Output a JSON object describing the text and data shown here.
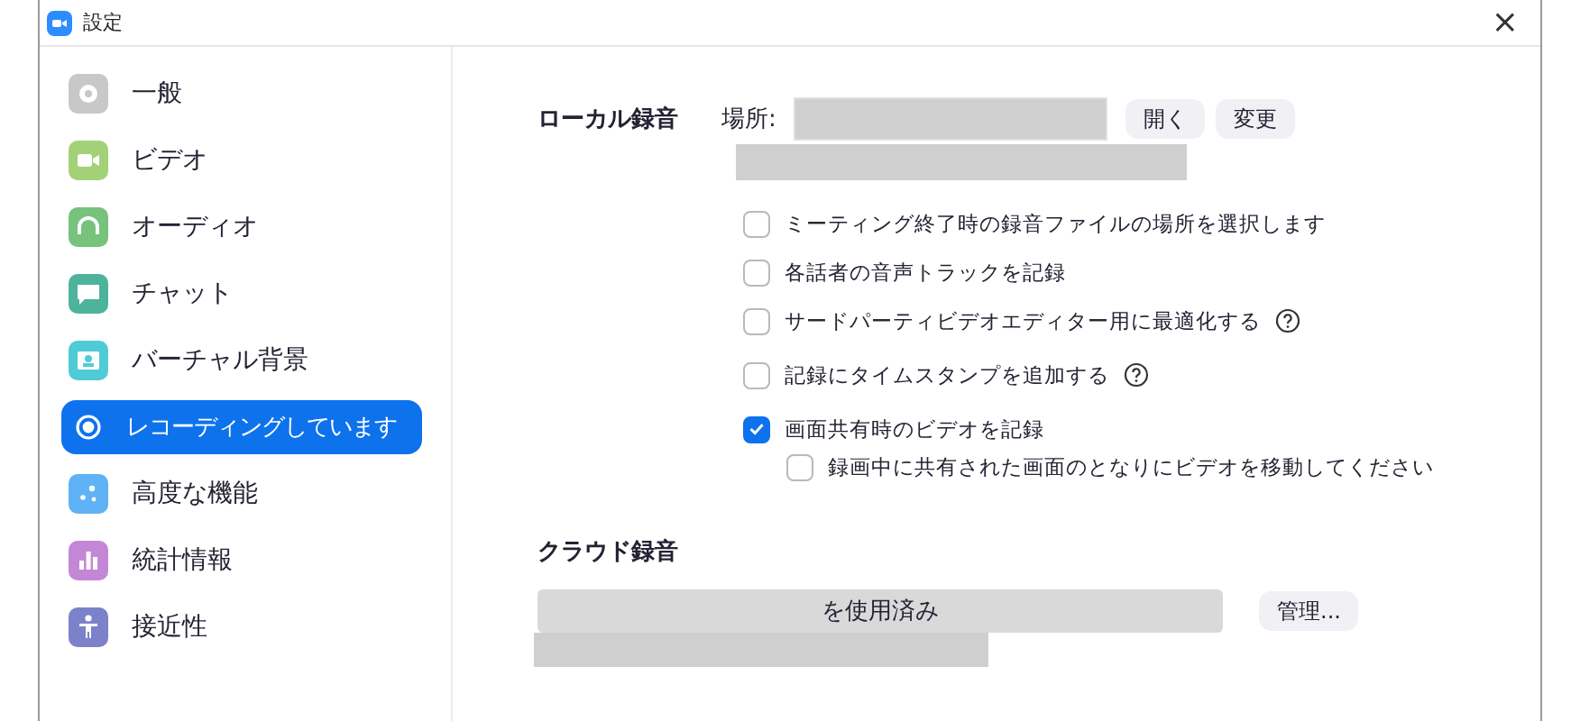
{
  "window": {
    "title": "設定",
    "close": "×"
  },
  "sidebar": {
    "items": [
      {
        "label": "一般",
        "color": "#c8c8c8",
        "selected": false
      },
      {
        "label": "ビデオ",
        "color": "#a3d178",
        "selected": false
      },
      {
        "label": "オーディオ",
        "color": "#77c27c",
        "selected": false
      },
      {
        "label": "チャット",
        "color": "#4db39b",
        "selected": false
      },
      {
        "label": "バーチャル背景",
        "color": "#4fcbd8",
        "selected": false
      },
      {
        "label": "レコーディングしています",
        "color": "#0e72ed",
        "selected": true
      },
      {
        "label": "高度な機能",
        "color": "#5eb2f5",
        "selected": false
      },
      {
        "label": "統計情報",
        "color": "#c487d6",
        "selected": false
      },
      {
        "label": "接近性",
        "color": "#7b82c9",
        "selected": false
      }
    ]
  },
  "local_recording": {
    "title": "ローカル録音",
    "location_label": "場所:",
    "buttons": [
      "開く",
      "変更"
    ],
    "options": [
      {
        "label": "ミーティング終了時の録音ファイルの場所を選択します",
        "checked": false,
        "help": false
      },
      {
        "label": "各話者の音声トラックを記録",
        "checked": false,
        "help": false
      },
      {
        "label": "サードパーティビデオエディター用に最適化する",
        "checked": false,
        "help": true
      },
      {
        "label": "記録にタイムスタンプを追加する",
        "checked": false,
        "help": true
      },
      {
        "label": "画面共有時のビデオを記録",
        "checked": true,
        "help": false,
        "children": [
          {
            "label": "録画中に共有された画面のとなりにビデオを移動してください",
            "checked": false,
            "help": false
          }
        ]
      }
    ]
  },
  "cloud_recording": {
    "title": "クラウド録音",
    "usage": "を使用済み",
    "button": "管理..."
  }
}
